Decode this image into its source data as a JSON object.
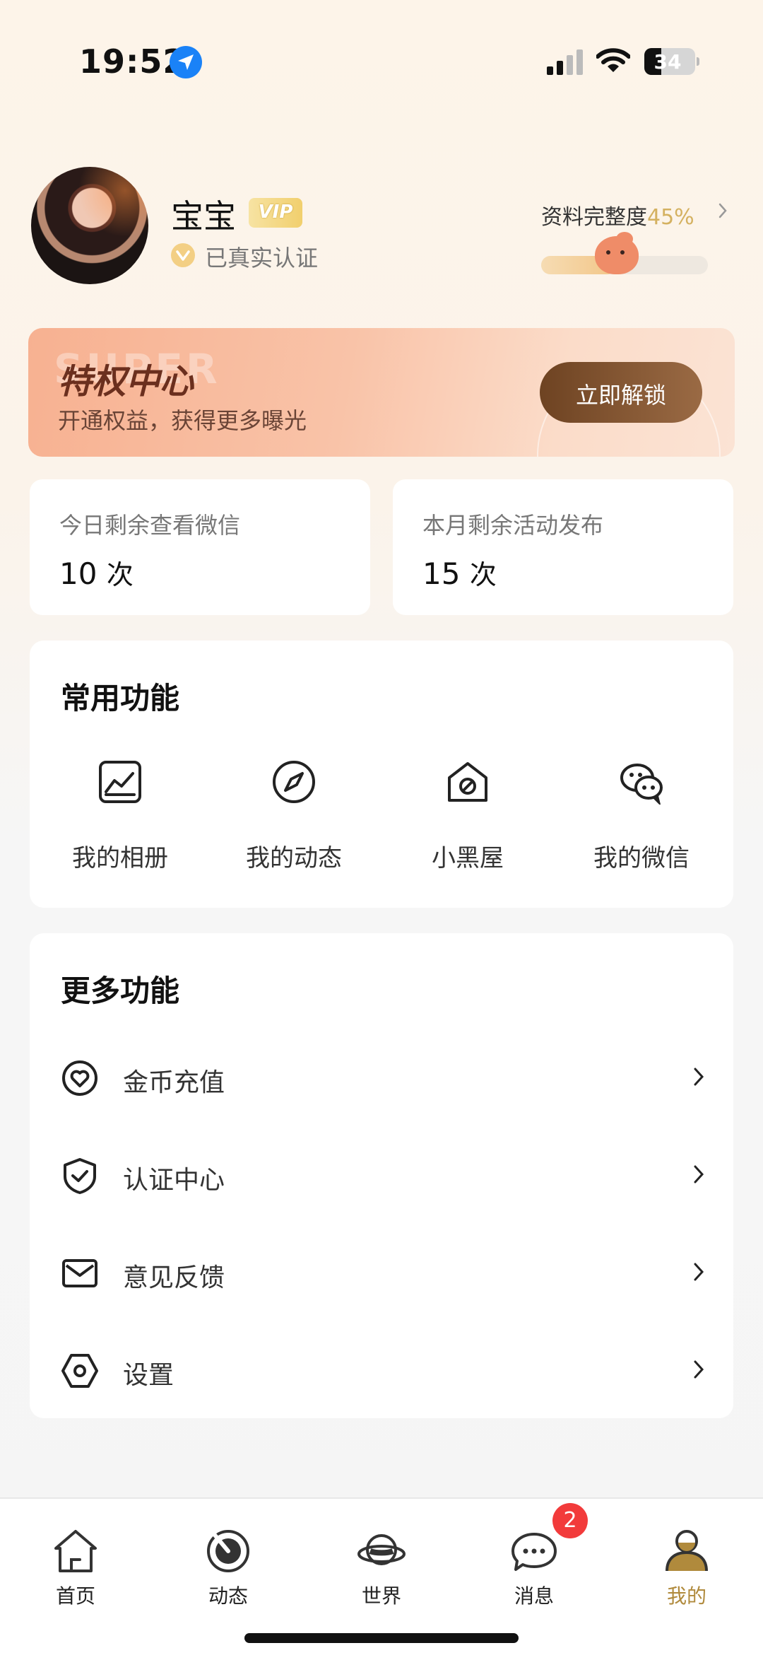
{
  "status_bar": {
    "time": "19:52",
    "battery": "34",
    "battery_level": 0.34
  },
  "profile": {
    "name": "宝宝",
    "vip_label": "VIP",
    "verified_text": "已真实认证",
    "completeness_label": "资料完整度",
    "completeness_value": "45%",
    "completeness_fraction": 0.45
  },
  "privilege": {
    "bg_word": "SUPER",
    "title": "特权中心",
    "subtitle": "开通权益，获得更多曝光",
    "button": "立即解锁"
  },
  "stats": [
    {
      "label": "今日剩余查看微信",
      "value": "10",
      "unit": "次"
    },
    {
      "label": "本月剩余活动发布",
      "value": "15",
      "unit": "次"
    }
  ],
  "common": {
    "title": "常用功能",
    "items": [
      {
        "label": "我的相册",
        "icon": "album-icon"
      },
      {
        "label": "我的动态",
        "icon": "compass-icon"
      },
      {
        "label": "小黑屋",
        "icon": "blocked-house-icon"
      },
      {
        "label": "我的微信",
        "icon": "wechat-icon"
      }
    ]
  },
  "more": {
    "title": "更多功能",
    "items": [
      {
        "label": "金币充值",
        "icon": "coin-heart-icon"
      },
      {
        "label": "认证中心",
        "icon": "shield-check-icon"
      },
      {
        "label": "意见反馈",
        "icon": "mail-icon"
      },
      {
        "label": "设置",
        "icon": "settings-hexagon-icon"
      }
    ]
  },
  "tabs": [
    {
      "label": "首页",
      "icon": "home-icon"
    },
    {
      "label": "动态",
      "icon": "dial-icon"
    },
    {
      "label": "世界",
      "icon": "planet-icon"
    },
    {
      "label": "消息",
      "icon": "chat-bubble-icon",
      "badge": "2"
    },
    {
      "label": "我的",
      "icon": "person-icon",
      "active": true
    }
  ],
  "colors": {
    "accent_gold": "#b08a3c",
    "badge_red": "#f23b3b",
    "button_brown": "#7a4e2c"
  }
}
